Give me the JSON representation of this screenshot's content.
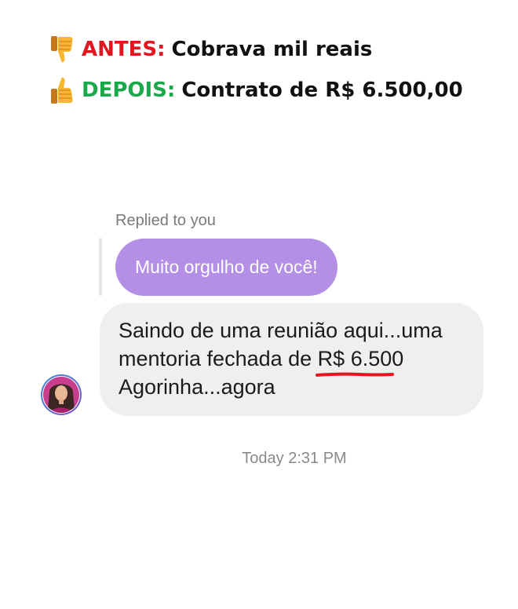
{
  "headlines": {
    "before": {
      "icon": "thumbs-down-icon",
      "label": "ANTES:",
      "text": "Cobrava mil reais",
      "label_color": "#e3161f"
    },
    "after": {
      "icon": "thumbs-up-icon",
      "label": "DEPOIS:",
      "text": "Contrato de R$ 6.500,00",
      "label_color": "#1aa84a"
    }
  },
  "chat": {
    "replied_label": "Replied to you",
    "reply_message": "Muito orgulho de você!",
    "reply_bubble_color": "#b38fe6",
    "message": {
      "line1": "Saindo de uma reunião aqui...uma",
      "line2_prefix": "mentoria fechada de ",
      "line2_highlight": "R$ 6.500",
      "line3": "Agorinha...agora",
      "highlight_underline_color": "#e3161f"
    },
    "avatar": "profile-avatar",
    "timestamp": "Today 2:31 PM"
  }
}
